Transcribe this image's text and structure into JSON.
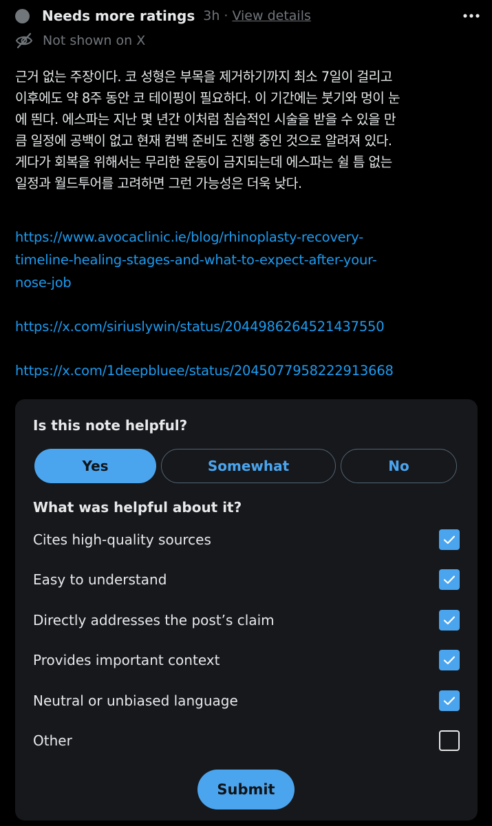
{
  "header": {
    "status_title": "Needs more ratings",
    "time": "3h",
    "separator": "·",
    "view_details": "View details",
    "not_shown": "Not shown on X"
  },
  "note": {
    "lines": [
      "근거 없는 주장이다. 코 성형은 부목을 제거하기까지 최소 7일이 걸리고",
      "이후에도 약 8주 동안 코 테이핑이 필요하다. 이 기간에는 붓기와 멍이 눈",
      "에 띈다. 에스파는 지난 몇 년간 이처럼 침습적인 시술을 받을 수 있을 만",
      "큼 일정에 공백이 없고 현재 컴백 준비도 진행 중인 것으로 알려져 있다.",
      "게다가 회복을 위해서는 무리한 운동이 금지되는데 에스파는 쉴 틈 없는",
      "일정과 월드투어를 고려하면 그런 가능성은 더욱 낮다."
    ],
    "links": [
      {
        "lines": [
          "https://www.avocaclinic.ie/blog/rhinoplasty-recovery-",
          "timeline-healing-stages-and-what-to-expect-after-your-",
          "nose-job"
        ]
      },
      {
        "lines": [
          "https://x.com/siriuslywin/status/2044986264521437550"
        ]
      },
      {
        "lines": [
          "https://x.com/1deepbluee/status/2045077958222913668"
        ]
      }
    ]
  },
  "rating": {
    "question": "Is this note helpful?",
    "choices": {
      "yes": "Yes",
      "somewhat": "Somewhat",
      "no": "No"
    },
    "selected": "Yes",
    "reasons_question": "What was helpful about it?",
    "options": [
      {
        "label": "Cites high-quality sources",
        "checked": true
      },
      {
        "label": "Easy to understand",
        "checked": true
      },
      {
        "label": "Directly addresses the post’s claim",
        "checked": true
      },
      {
        "label": "Provides important context",
        "checked": true
      },
      {
        "label": "Neutral or unbiased language",
        "checked": true
      },
      {
        "label": "Other",
        "checked": false
      }
    ],
    "submit": "Submit"
  },
  "colors": {
    "background": "#000000",
    "panel": "#16181c",
    "accent": "#4ba5ee",
    "link": "#1d9bf0",
    "muted": "#71767b"
  },
  "icons": {
    "more": "more-horizontal-icon",
    "hidden": "eye-off-icon",
    "check": "checkmark-icon"
  }
}
